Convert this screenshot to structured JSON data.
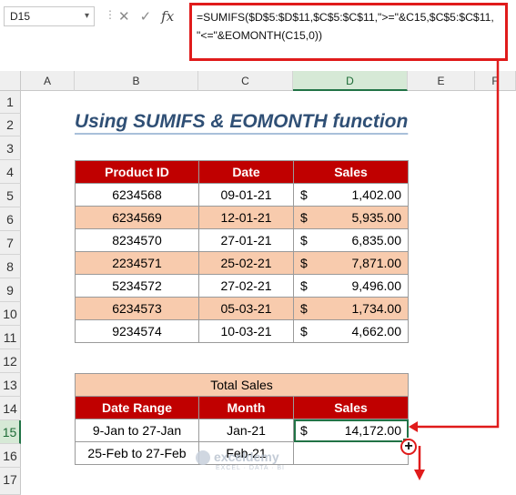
{
  "namebox": {
    "value": "D15"
  },
  "formula_bar": {
    "line1": "=SUMIFS($D$5:$D$11,$C$5:$C$11,\">=\"&C15,$C$5:$C$11,",
    "line2": "\"<=\"&EOMONTH(C15,0))"
  },
  "columns": [
    "A",
    "B",
    "C",
    "D",
    "E",
    "F"
  ],
  "rows": [
    "1",
    "2",
    "3",
    "4",
    "5",
    "6",
    "7",
    "8",
    "9",
    "10",
    "11",
    "12",
    "13",
    "14",
    "15",
    "16",
    "17"
  ],
  "title": "Using SUMIFS & EOMONTH function",
  "table1": {
    "headers": [
      "Product ID",
      "Date",
      "Sales"
    ],
    "rows": [
      {
        "id": "6234568",
        "date": "09-01-21",
        "cur": "$",
        "sales": "1,402.00"
      },
      {
        "id": "6234569",
        "date": "12-01-21",
        "cur": "$",
        "sales": "5,935.00"
      },
      {
        "id": "8234570",
        "date": "27-01-21",
        "cur": "$",
        "sales": "6,835.00"
      },
      {
        "id": "2234571",
        "date": "25-02-21",
        "cur": "$",
        "sales": "7,871.00"
      },
      {
        "id": "5234572",
        "date": "27-02-21",
        "cur": "$",
        "sales": "9,496.00"
      },
      {
        "id": "6234573",
        "date": "05-03-21",
        "cur": "$",
        "sales": "1,734.00"
      },
      {
        "id": "9234574",
        "date": "10-03-21",
        "cur": "$",
        "sales": "4,662.00"
      }
    ]
  },
  "table2": {
    "caption": "Total Sales",
    "headers": [
      "Date Range",
      "Month",
      "Sales"
    ],
    "rows": [
      {
        "range": "9-Jan to 27-Jan",
        "month": "Jan-21",
        "cur": "$",
        "sales": "14,172.00"
      },
      {
        "range": "25-Feb to 27-Feb",
        "month": "Feb-21",
        "cur": "",
        "sales": ""
      }
    ]
  },
  "watermark": {
    "name": "exceldemy",
    "tagline": "EXCEL · DATA · BI"
  },
  "colors": {
    "header_red": "#c00000",
    "shade": "#f8cbad",
    "select_green": "#217346",
    "annotation_red": "#e01b1b"
  }
}
